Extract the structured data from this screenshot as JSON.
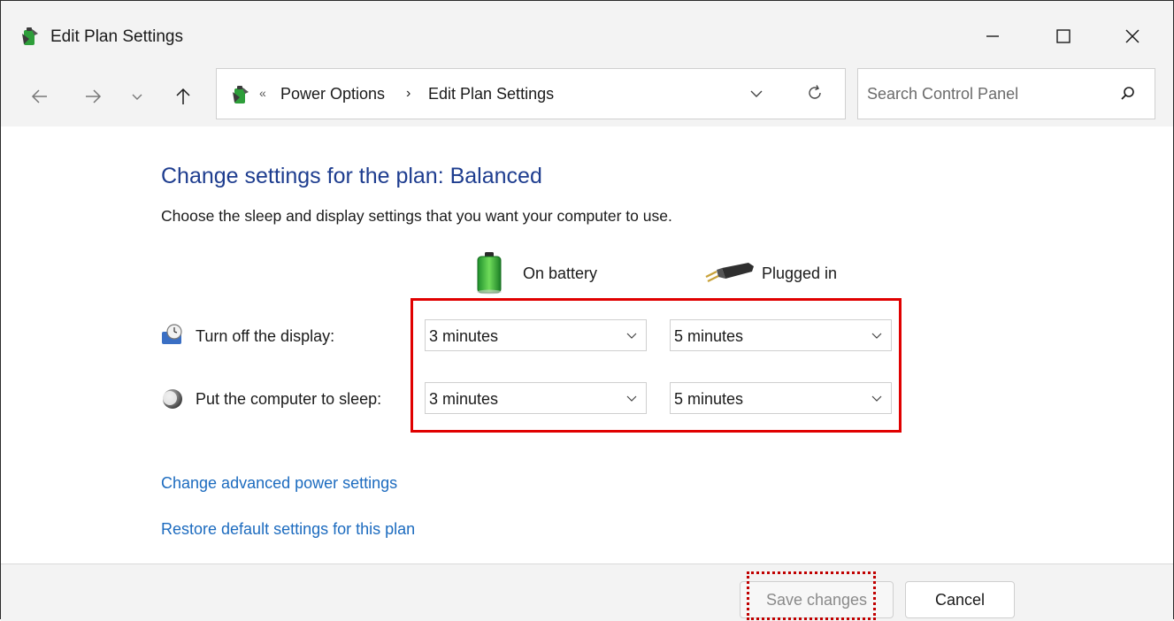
{
  "window": {
    "title": "Edit Plan Settings",
    "controls": {
      "minimize": "minimize-icon",
      "maximize": "maximize-icon",
      "close": "close-icon"
    }
  },
  "nav": {
    "breadcrumb_prefix": "«",
    "breadcrumbs": [
      "Power Options",
      "Edit Plan Settings"
    ],
    "breadcrumb_separator": "›",
    "search_placeholder": "Search Control Panel"
  },
  "content": {
    "heading": "Change settings for the plan: Balanced",
    "subheading": "Choose the sleep and display settings that you want your computer to use.",
    "columns": {
      "battery": "On battery",
      "plugged": "Plugged in"
    },
    "rows": [
      {
        "label": "Turn off the display:",
        "battery": "3 minutes",
        "plugged": "5 minutes"
      },
      {
        "label": "Put the computer to sleep:",
        "battery": "3 minutes",
        "plugged": "5 minutes"
      }
    ],
    "links": {
      "advanced": "Change advanced power settings",
      "restore": "Restore default settings for this plan"
    }
  },
  "footer": {
    "save": "Save changes",
    "cancel": "Cancel"
  },
  "colors": {
    "heading": "#1e3d8f",
    "link": "#1c6bbf",
    "highlight": "#e00000"
  }
}
